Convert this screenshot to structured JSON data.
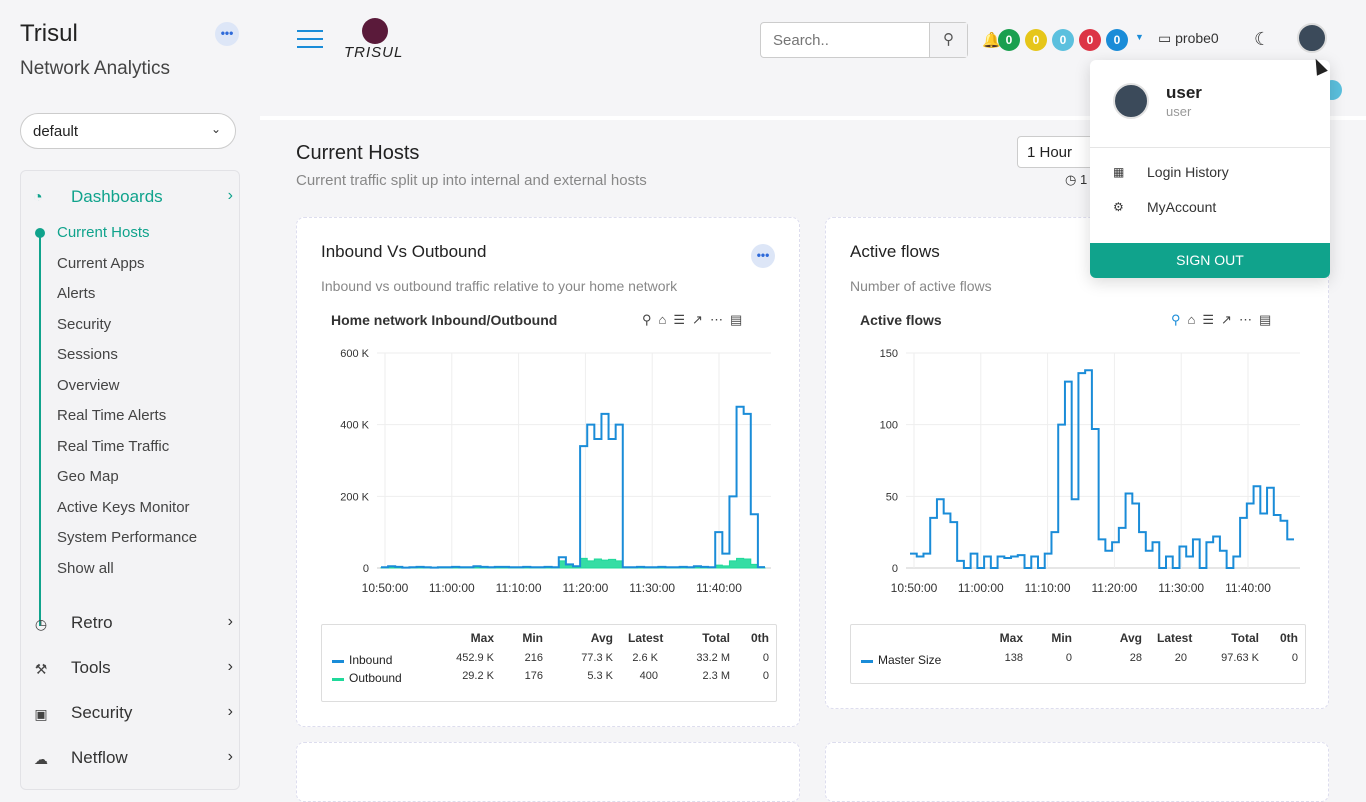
{
  "sidebar": {
    "brand": "Trisul",
    "subtitle": "Network Analytics",
    "more": "•••",
    "context_select": "default",
    "dashboards": {
      "label": "Dashboards",
      "icon": "dashboard-icon"
    },
    "items": [
      "Current Hosts",
      "Current Apps",
      "Alerts",
      "Security",
      "Sessions",
      "Overview",
      "Real Time Alerts",
      "Real Time Traffic",
      "Geo Map",
      "Active Keys Monitor",
      "System Performance",
      "Show all"
    ],
    "groups": [
      {
        "label": "Retro",
        "icon": "clock-icon"
      },
      {
        "label": "Tools",
        "icon": "wrench-icon"
      },
      {
        "label": "Security",
        "icon": "lock-icon"
      },
      {
        "label": "Netflow",
        "icon": "cloud-icon"
      }
    ]
  },
  "topbar": {
    "logo_text": "TRISUL",
    "search_placeholder": "Search..",
    "counts": [
      {
        "value": "0",
        "color": "#1a9f4f"
      },
      {
        "value": "0",
        "color": "#e6c619"
      },
      {
        "value": "0",
        "color": "#5bc0de"
      },
      {
        "value": "0",
        "color": "#dc3545"
      },
      {
        "value": "0",
        "color": "#1a8cd8"
      }
    ],
    "probe": "probe0"
  },
  "page": {
    "title": "Current Hosts",
    "subtitle": "Current traffic split up into internal and external hosts",
    "time_select": "1 Hour",
    "clock_prefix": "1"
  },
  "cards": [
    {
      "title": "Inbound Vs Outbound",
      "subtitle": "Inbound vs outbound traffic relative to your home network",
      "chart_name": "Home network Inbound/Outbound",
      "legend_headers": [
        "Max",
        "Min",
        "Avg",
        "Latest",
        "Total",
        "0th"
      ],
      "legend_rows": [
        {
          "name": "Inbound",
          "color": "#1a8cd8",
          "values": [
            "452.9 K",
            "216",
            "77.3 K",
            "2.6 K",
            "33.2 M",
            "0"
          ]
        },
        {
          "name": "Outbound",
          "color": "#1fd99a",
          "values": [
            "29.2 K",
            "176",
            "5.3 K",
            "400",
            "2.3 M",
            "0"
          ]
        }
      ]
    },
    {
      "title": "Active flows",
      "subtitle": "Number of active flows",
      "chart_name": "Active flows",
      "legend_headers": [
        "Max",
        "Min",
        "Avg",
        "Latest",
        "Total",
        "0th"
      ],
      "legend_rows": [
        {
          "name": "Master Size",
          "color": "#1a8cd8",
          "values": [
            "138",
            "0",
            "28",
            "20",
            "97.63 K",
            "0"
          ]
        }
      ]
    }
  ],
  "chart_data": [
    {
      "type": "area",
      "title": "Home network Inbound/Outbound",
      "x": [
        "10:50:00",
        "11:00:00",
        "11:10:00",
        "11:20:00",
        "11:30:00",
        "11:40:00"
      ],
      "ylim": [
        0,
        600000
      ],
      "yticks": [
        "0",
        "200 K",
        "400 K",
        "600 K"
      ],
      "series": [
        {
          "name": "Inbound",
          "values": [
            2000,
            5000,
            3000,
            1000,
            2000,
            3000,
            2000,
            1000,
            2000,
            2000,
            3000,
            2000,
            2000,
            5000,
            3000,
            2000,
            3000,
            3000,
            2000,
            2000,
            3000,
            2000,
            2000,
            3000,
            2000,
            30000,
            10000,
            5000,
            340000,
            400000,
            360000,
            430000,
            360000,
            400000,
            2000,
            2000,
            3000,
            2000,
            2000,
            3000,
            2000,
            2000,
            3000,
            2000,
            5000,
            3000,
            2000,
            100000,
            40000,
            200000,
            450000,
            430000,
            150000,
            2600
          ]
        },
        {
          "name": "Outbound",
          "values": [
            1000,
            2000,
            1000,
            1000,
            1000,
            2000,
            1000,
            1000,
            1000,
            1000,
            2000,
            1000,
            1000,
            3000,
            2000,
            1000,
            2000,
            2000,
            1000,
            1000,
            2000,
            1000,
            1000,
            2000,
            1000,
            20000,
            8000,
            4000,
            27000,
            20000,
            25000,
            22000,
            24000,
            20000,
            1000,
            1000,
            2000,
            1000,
            1000,
            2000,
            1000,
            1000,
            2000,
            1000,
            3000,
            2000,
            1000,
            8000,
            6000,
            20000,
            27000,
            25000,
            10000,
            400
          ]
        }
      ]
    },
    {
      "type": "line",
      "title": "Active flows",
      "x": [
        "10:50:00",
        "11:00:00",
        "11:10:00",
        "11:20:00",
        "11:30:00",
        "11:40:00"
      ],
      "ylim": [
        0,
        150
      ],
      "yticks": [
        "0",
        "50",
        "100",
        "150"
      ],
      "series": [
        {
          "name": "Master Size",
          "values": [
            10,
            8,
            10,
            35,
            48,
            38,
            32,
            5,
            0,
            10,
            0,
            8,
            0,
            8,
            7,
            8,
            9,
            0,
            8,
            0,
            10,
            25,
            100,
            130,
            48,
            136,
            138,
            97,
            20,
            12,
            18,
            28,
            52,
            45,
            25,
            12,
            18,
            0,
            8,
            0,
            15,
            8,
            20,
            0,
            18,
            22,
            12,
            0,
            8,
            35,
            45,
            57,
            38,
            56,
            37,
            33,
            20
          ]
        }
      ]
    }
  ],
  "dropdown": {
    "name": "user",
    "role": "user",
    "items": [
      {
        "label": "Login History",
        "icon": "table-icon"
      },
      {
        "label": "MyAccount",
        "icon": "gear-icon"
      }
    ],
    "signout": "SIGN OUT"
  }
}
